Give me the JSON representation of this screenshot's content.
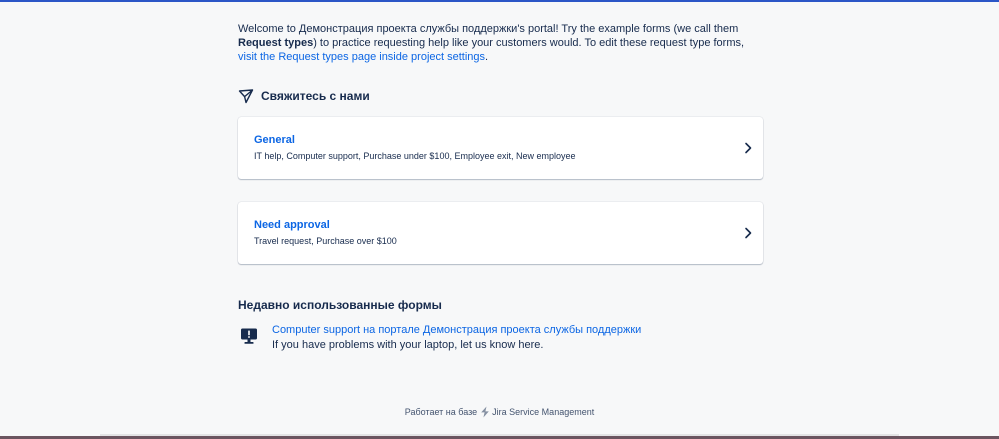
{
  "intro": {
    "text_start": "Welcome to Демонстрация проекта службы поддержки's portal! Try the example forms (we call them ",
    "bold_term": "Request types",
    "text_mid": ") to practice requesting help like your customers would. To edit these request type forms, ",
    "link_text": "visit the Request types page inside project settings",
    "text_end": "."
  },
  "contact": {
    "title": "Свяжитесь с нами",
    "icon": "paper-plane-icon"
  },
  "groups": [
    {
      "title": "General",
      "description": "IT help, Computer support, Purchase under $100, Employee exit, New employee"
    },
    {
      "title": "Need approval",
      "description": "Travel request, Purchase over $100"
    }
  ],
  "recent": {
    "title": "Недавно использованные формы",
    "items": [
      {
        "icon": "computer-monitor-icon",
        "link": "Computer support на портале Демонстрация проекта службы поддержки",
        "description": "If you have problems with your laptop, let us know here."
      }
    ]
  },
  "footer": {
    "powered_by": "Работает на базе",
    "product": "Jira Service Management"
  },
  "colors": {
    "link": "#0c66e4",
    "text": "#172b4d",
    "background": "#f7f8f9",
    "top_bar": "#2b56c7"
  }
}
